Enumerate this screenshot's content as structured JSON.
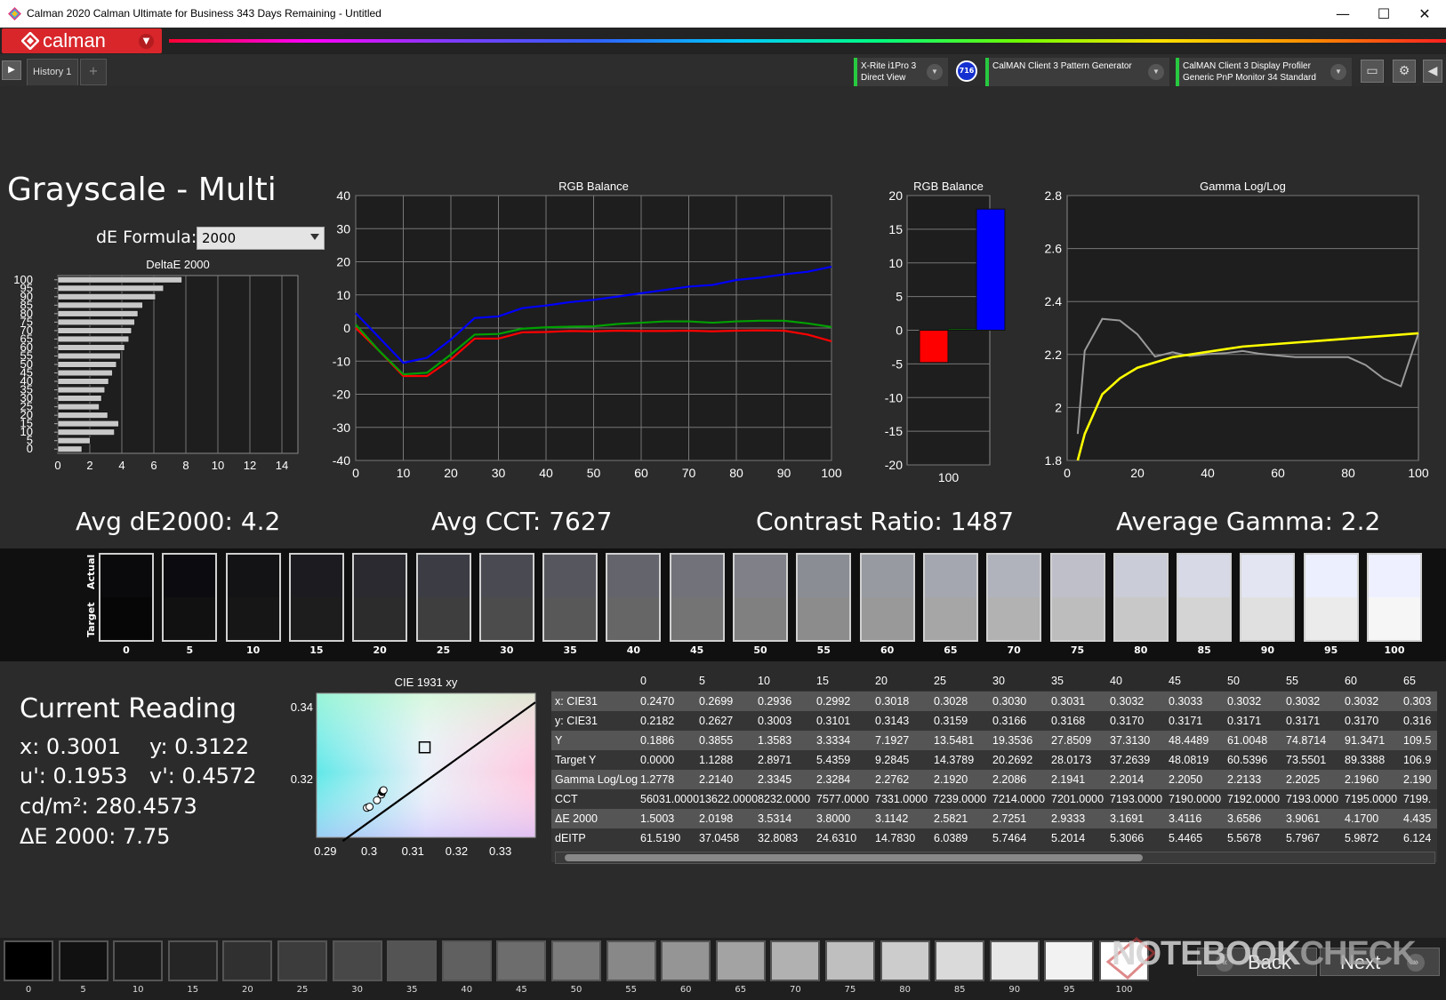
{
  "window": {
    "title": "Calman 2020 Calman Ultimate for Business 343 Days Remaining  - Untitled",
    "minimize": "—",
    "maximize": "☐",
    "close": "✕"
  },
  "brand": {
    "logo_text": "calman",
    "accent": "#d8262b"
  },
  "tabs": {
    "history_label": "History 1",
    "add_label": "+"
  },
  "devices": [
    {
      "line1": "X-Rite i1Pro 3",
      "line2": "Direct View"
    },
    {
      "line1": "CalMAN Client 3 Pattern Generator",
      "line2": ""
    },
    {
      "line1": "CalMAN Client 3 Display Profiler",
      "line2": "Generic PnP Monitor 34 Standard"
    }
  ],
  "meter_badge": "716",
  "page": {
    "title": "Grayscale - Multi",
    "formula_label": "dE Formula:",
    "formula_value": "2000"
  },
  "stats": {
    "avg_de": "Avg dE2000: 4.2",
    "avg_cct": "Avg CCT: 7627",
    "contrast": "Contrast Ratio: 1487",
    "avg_gamma": "Average Gamma: 2.2"
  },
  "chart_data": [
    {
      "type": "bar",
      "title": "DeltaE 2000",
      "orientation": "horizontal",
      "categories": [
        "0",
        "5",
        "10",
        "15",
        "20",
        "25",
        "30",
        "35",
        "40",
        "45",
        "50",
        "55",
        "60",
        "65",
        "70",
        "75",
        "80",
        "85",
        "90",
        "95",
        "100"
      ],
      "values": [
        1.5003,
        2.0198,
        3.5314,
        3.8,
        3.1142,
        2.5821,
        2.7251,
        2.9333,
        3.1691,
        3.4116,
        3.6586,
        3.9061,
        4.17,
        4.435,
        4.6,
        4.8,
        5.0,
        5.3,
        6.1,
        6.6,
        7.75
      ],
      "xlim": [
        0,
        15
      ],
      "xticks": [
        "0",
        "2",
        "4",
        "6",
        "8",
        "10",
        "12",
        "14"
      ]
    },
    {
      "type": "line",
      "title": "RGB Balance",
      "x": [
        0,
        5,
        10,
        15,
        20,
        25,
        30,
        35,
        40,
        45,
        50,
        55,
        60,
        65,
        70,
        75,
        80,
        85,
        90,
        95,
        100
      ],
      "series": [
        {
          "color": "#ff0000",
          "values": [
            0,
            -7,
            -14.5,
            -14.5,
            -9.5,
            -3.2,
            -3.2,
            -1.3,
            -1.2,
            -0.9,
            -1.0,
            -0.8,
            -0.9,
            -0.9,
            -0.8,
            -1.0,
            -0.8,
            -0.7,
            -0.8,
            -2.0,
            -4.0
          ]
        },
        {
          "color": "#00a000",
          "values": [
            1,
            -7,
            -14,
            -13.5,
            -8,
            -2,
            -1.8,
            -0.2,
            0.2,
            0.4,
            0.5,
            1.2,
            1.6,
            2,
            2,
            1.6,
            2,
            2.2,
            2.2,
            1.4,
            0.3
          ]
        },
        {
          "color": "#0000ff",
          "values": [
            4.5,
            -3,
            -10.5,
            -9,
            -3.5,
            3,
            3.5,
            6,
            6.8,
            7.8,
            8.5,
            9.5,
            10.5,
            11.5,
            12.5,
            13,
            14.5,
            15.2,
            16.2,
            17,
            18.5
          ]
        }
      ],
      "xlim": [
        0,
        100
      ],
      "ylim": [
        -40,
        40
      ],
      "xticks": [
        "0",
        "10",
        "20",
        "30",
        "40",
        "50",
        "60",
        "70",
        "80",
        "90",
        "100"
      ],
      "yticks": [
        "40",
        "30",
        "20",
        "10",
        "0",
        "-10",
        "-20",
        "-30",
        "-40"
      ]
    },
    {
      "type": "bar",
      "title": "RGB Balance",
      "categories": [
        "100"
      ],
      "series": [
        {
          "color": "#ff0000",
          "values": [
            -4.8
          ]
        },
        {
          "color": "#00a000",
          "values": [
            0.2
          ]
        },
        {
          "color": "#0000ff",
          "values": [
            18.0
          ]
        }
      ],
      "ylim": [
        -20,
        20
      ],
      "yticks": [
        "20",
        "15",
        "10",
        "5",
        "0",
        "-5",
        "-10",
        "-15",
        "-20"
      ]
    },
    {
      "type": "line",
      "title": "Gamma Log/Log",
      "x": [
        3,
        5,
        10,
        15,
        20,
        25,
        30,
        35,
        40,
        45,
        50,
        55,
        60,
        65,
        70,
        75,
        80,
        85,
        90,
        95,
        100
      ],
      "series": [
        {
          "color": "#9a9a9a",
          "values": [
            1.9,
            2.214,
            2.3345,
            2.3284,
            2.2762,
            2.192,
            2.2086,
            2.1941,
            2.2014,
            2.205,
            2.2133,
            2.2025,
            2.196,
            2.19,
            2.19,
            2.19,
            2.19,
            2.16,
            2.11,
            2.08,
            2.28
          ]
        },
        {
          "color": "#ffff00",
          "values": [
            1.8,
            1.9,
            2.05,
            2.11,
            2.15,
            2.17,
            2.19,
            2.2,
            2.21,
            2.22,
            2.23,
            2.235,
            2.24,
            2.245,
            2.25,
            2.255,
            2.26,
            2.265,
            2.27,
            2.275,
            2.28
          ]
        }
      ],
      "xlim": [
        0,
        100
      ],
      "ylim": [
        1.8,
        2.8
      ],
      "xticks": [
        "0",
        "20",
        "40",
        "60",
        "80",
        "100"
      ],
      "yticks": [
        "2.8",
        "2.6",
        "2.4",
        "2.2",
        "2",
        "1.8"
      ]
    },
    {
      "type": "scatter",
      "title": "CIE 1931 xy",
      "xlim": [
        0.288,
        0.338
      ],
      "ylim": [
        0.304,
        0.344
      ],
      "xticks": [
        "0.29",
        "0.3",
        "0.31",
        "0.31",
        "0.32",
        "0.33"
      ],
      "yticks": [
        "0.34",
        "0.32"
      ],
      "points": [
        [
          0.2995,
          0.3122
        ],
        [
          0.3001,
          0.3125
        ],
        [
          0.3018,
          0.3143
        ],
        [
          0.3028,
          0.3159
        ],
        [
          0.303,
          0.3166
        ],
        [
          0.3031,
          0.3168
        ],
        [
          0.3032,
          0.317
        ],
        [
          0.3033,
          0.3171
        ]
      ],
      "target": [
        0.3127,
        0.329
      ]
    }
  ],
  "swatches": {
    "actual_label": "Actual",
    "target_label": "Target",
    "items": [
      {
        "label": "0",
        "actual": "#0a0a0c",
        "target": "#060606"
      },
      {
        "label": "5",
        "actual": "#0c0c10",
        "target": "#111111"
      },
      {
        "label": "10",
        "actual": "#131316",
        "target": "#161616"
      },
      {
        "label": "15",
        "actual": "#1c1c20",
        "target": "#1d1d1d"
      },
      {
        "label": "20",
        "actual": "#2a2a30",
        "target": "#2c2c2c"
      },
      {
        "label": "25",
        "actual": "#3c3d44",
        "target": "#3e3e3e"
      },
      {
        "label": "30",
        "actual": "#4a4b52",
        "target": "#4c4c4c"
      },
      {
        "label": "35",
        "actual": "#56575e",
        "target": "#585858"
      },
      {
        "label": "40",
        "actual": "#64656c",
        "target": "#666666"
      },
      {
        "label": "45",
        "actual": "#72737a",
        "target": "#747474"
      },
      {
        "label": "50",
        "actual": "#7f8088",
        "target": "#808080"
      },
      {
        "label": "55",
        "actual": "#8b8d95",
        "target": "#8c8c8c"
      },
      {
        "label": "60",
        "actual": "#989aa2",
        "target": "#999999"
      },
      {
        "label": "65",
        "actual": "#a5a7b0",
        "target": "#a6a6a6"
      },
      {
        "label": "70",
        "actual": "#b1b3bc",
        "target": "#b2b2b2"
      },
      {
        "label": "75",
        "actual": "#bebfc9",
        "target": "#bdbdbd"
      },
      {
        "label": "80",
        "actual": "#caccd7",
        "target": "#c8c8c8"
      },
      {
        "label": "85",
        "actual": "#d7d9e6",
        "target": "#d4d4d4"
      },
      {
        "label": "90",
        "actual": "#e3e5f2",
        "target": "#e0e0e0"
      },
      {
        "label": "95",
        "actual": "#eceffd",
        "target": "#ebebeb"
      },
      {
        "label": "100",
        "actual": "#eef0ff",
        "target": "#f6f6f6"
      }
    ]
  },
  "reading": {
    "title": "Current Reading",
    "x": "x: 0.3001",
    "y": "y: 0.3122",
    "u": "u': 0.1953",
    "v": "v': 0.4572",
    "cd": "cd/m²: 280.4573",
    "de": "ΔE 2000: 7.75"
  },
  "table": {
    "columns": [
      "0",
      "5",
      "10",
      "15",
      "20",
      "25",
      "30",
      "35",
      "40",
      "45",
      "50",
      "55",
      "60",
      "65"
    ],
    "rows": [
      {
        "name": "x: CIE31",
        "cells": [
          "0.2470",
          "0.2699",
          "0.2936",
          "0.2992",
          "0.3018",
          "0.3028",
          "0.3030",
          "0.3031",
          "0.3032",
          "0.3033",
          "0.3032",
          "0.3032",
          "0.3032",
          "0.303"
        ]
      },
      {
        "name": "y: CIE31",
        "cells": [
          "0.2182",
          "0.2627",
          "0.3003",
          "0.3101",
          "0.3143",
          "0.3159",
          "0.3166",
          "0.3168",
          "0.3170",
          "0.3171",
          "0.3171",
          "0.3171",
          "0.3170",
          "0.316"
        ]
      },
      {
        "name": "Y",
        "cells": [
          "0.1886",
          "0.3855",
          "1.3583",
          "3.3334",
          "7.1927",
          "13.5481",
          "19.3536",
          "27.8509",
          "37.3130",
          "48.4489",
          "61.0048",
          "74.8714",
          "91.3471",
          "109.5"
        ]
      },
      {
        "name": "Target Y",
        "cells": [
          "0.0000",
          "1.1288",
          "2.8971",
          "5.4359",
          "9.2845",
          "14.3789",
          "20.2692",
          "28.0173",
          "37.2639",
          "48.0819",
          "60.5396",
          "73.5501",
          "89.3388",
          "106.9"
        ]
      },
      {
        "name": "Gamma Log/Log",
        "cells": [
          "1.2778",
          "2.2140",
          "2.3345",
          "2.3284",
          "2.2762",
          "2.1920",
          "2.2086",
          "2.1941",
          "2.2014",
          "2.2050",
          "2.2133",
          "2.2025",
          "2.1960",
          "2.190"
        ]
      },
      {
        "name": "CCT",
        "cells": [
          "56031.0000",
          "13622.0000",
          "8232.0000",
          "7577.0000",
          "7331.0000",
          "7239.0000",
          "7214.0000",
          "7201.0000",
          "7193.0000",
          "7190.0000",
          "7192.0000",
          "7193.0000",
          "7195.0000",
          "7199."
        ]
      },
      {
        "name": "ΔE 2000",
        "cells": [
          "1.5003",
          "2.0198",
          "3.5314",
          "3.8000",
          "3.1142",
          "2.5821",
          "2.7251",
          "2.9333",
          "3.1691",
          "3.4116",
          "3.6586",
          "3.9061",
          "4.1700",
          "4.435"
        ]
      },
      {
        "name": "dEITP",
        "cells": [
          "61.5190",
          "37.0458",
          "32.8083",
          "24.6310",
          "14.7830",
          "6.0389",
          "5.7464",
          "5.2014",
          "5.3066",
          "5.4465",
          "5.5678",
          "5.7967",
          "5.9872",
          "6.124"
        ]
      }
    ]
  },
  "bottom": {
    "swatches": [
      {
        "label": "0",
        "color": "#000000"
      },
      {
        "label": "5",
        "color": "#111111"
      },
      {
        "label": "10",
        "color": "#1b1b1b"
      },
      {
        "label": "15",
        "color": "#252525"
      },
      {
        "label": "20",
        "color": "#303030"
      },
      {
        "label": "25",
        "color": "#3c3c3c"
      },
      {
        "label": "30",
        "color": "#484848"
      },
      {
        "label": "35",
        "color": "#545454"
      },
      {
        "label": "40",
        "color": "#606060"
      },
      {
        "label": "45",
        "color": "#6d6d6d"
      },
      {
        "label": "50",
        "color": "#7b7b7b"
      },
      {
        "label": "55",
        "color": "#888888"
      },
      {
        "label": "60",
        "color": "#959595"
      },
      {
        "label": "65",
        "color": "#a3a3a3"
      },
      {
        "label": "70",
        "color": "#b1b1b1"
      },
      {
        "label": "75",
        "color": "#bfbfbf"
      },
      {
        "label": "80",
        "color": "#cccccc"
      },
      {
        "label": "85",
        "color": "#dadada"
      },
      {
        "label": "90",
        "color": "#e7e7e7"
      },
      {
        "label": "95",
        "color": "#f2f2f2"
      },
      {
        "label": "100",
        "color": "#ffffff"
      }
    ],
    "back_label": "Back",
    "next_label": "Next"
  },
  "watermark": {
    "text1": "NOTEBOOK",
    "text2": "CHECK"
  }
}
